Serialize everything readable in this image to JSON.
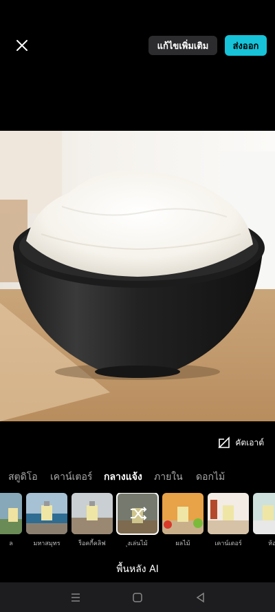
{
  "header": {
    "edit_more_label": "แก้ไขเพิ่มเติม",
    "export_label": "ส่งออก",
    "accent_color": "#16c3d8"
  },
  "icons": {
    "close": "close-icon",
    "cutout": "cutout-icon",
    "shuffle": "shuffle-icon",
    "nav_menu": "menu-icon",
    "nav_home": "home-icon",
    "nav_back": "back-icon"
  },
  "cutout_label": "คัตเอาต์",
  "tabs": [
    {
      "label": "สตูดิโอ",
      "active": false
    },
    {
      "label": "เคาน์เตอร์",
      "active": false
    },
    {
      "label": "กลางแจ้ง",
      "active": true
    },
    {
      "label": "ภายใน",
      "active": false
    },
    {
      "label": "ดอกไม้",
      "active": false
    }
  ],
  "thumbnails": [
    {
      "label": "ล"
    },
    {
      "label": "มหาสมุทร"
    },
    {
      "label": "ร็อคกี้คลิฟ"
    },
    {
      "label": "ุงเล่นไม้",
      "selected": true
    },
    {
      "label": "ผลไม้"
    },
    {
      "label": "เคาน์เตอร์"
    },
    {
      "label": "ห้อง"
    }
  ],
  "section_title": "พื้นหลัง AI"
}
